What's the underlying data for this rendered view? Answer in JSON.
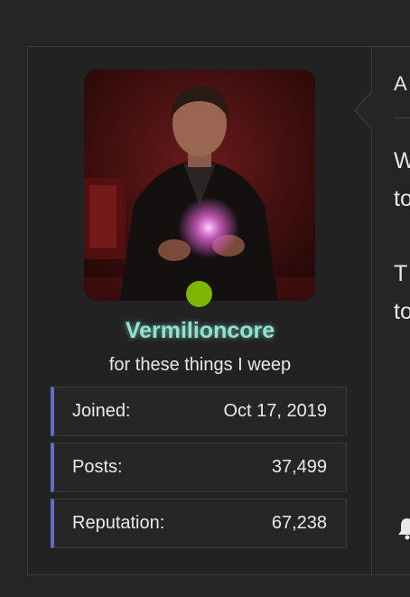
{
  "user": {
    "name": "Vermilioncore",
    "title": "for these things I weep",
    "online": true,
    "name_color": "#8fe3cf",
    "status_color": "#7cb600"
  },
  "stats": [
    {
      "label": "Joined:",
      "value": "Oct 17, 2019"
    },
    {
      "label": "Posts:",
      "value": "37,499"
    },
    {
      "label": "Reputation:",
      "value": "67,238"
    }
  ],
  "content": {
    "header_fragment": "A",
    "line1": "W",
    "line2": "to",
    "line3": "T",
    "line4": "to",
    "action_icon": "bell-icon"
  },
  "colors": {
    "accent_bar": "#5f6fc0",
    "background": "#252525"
  }
}
